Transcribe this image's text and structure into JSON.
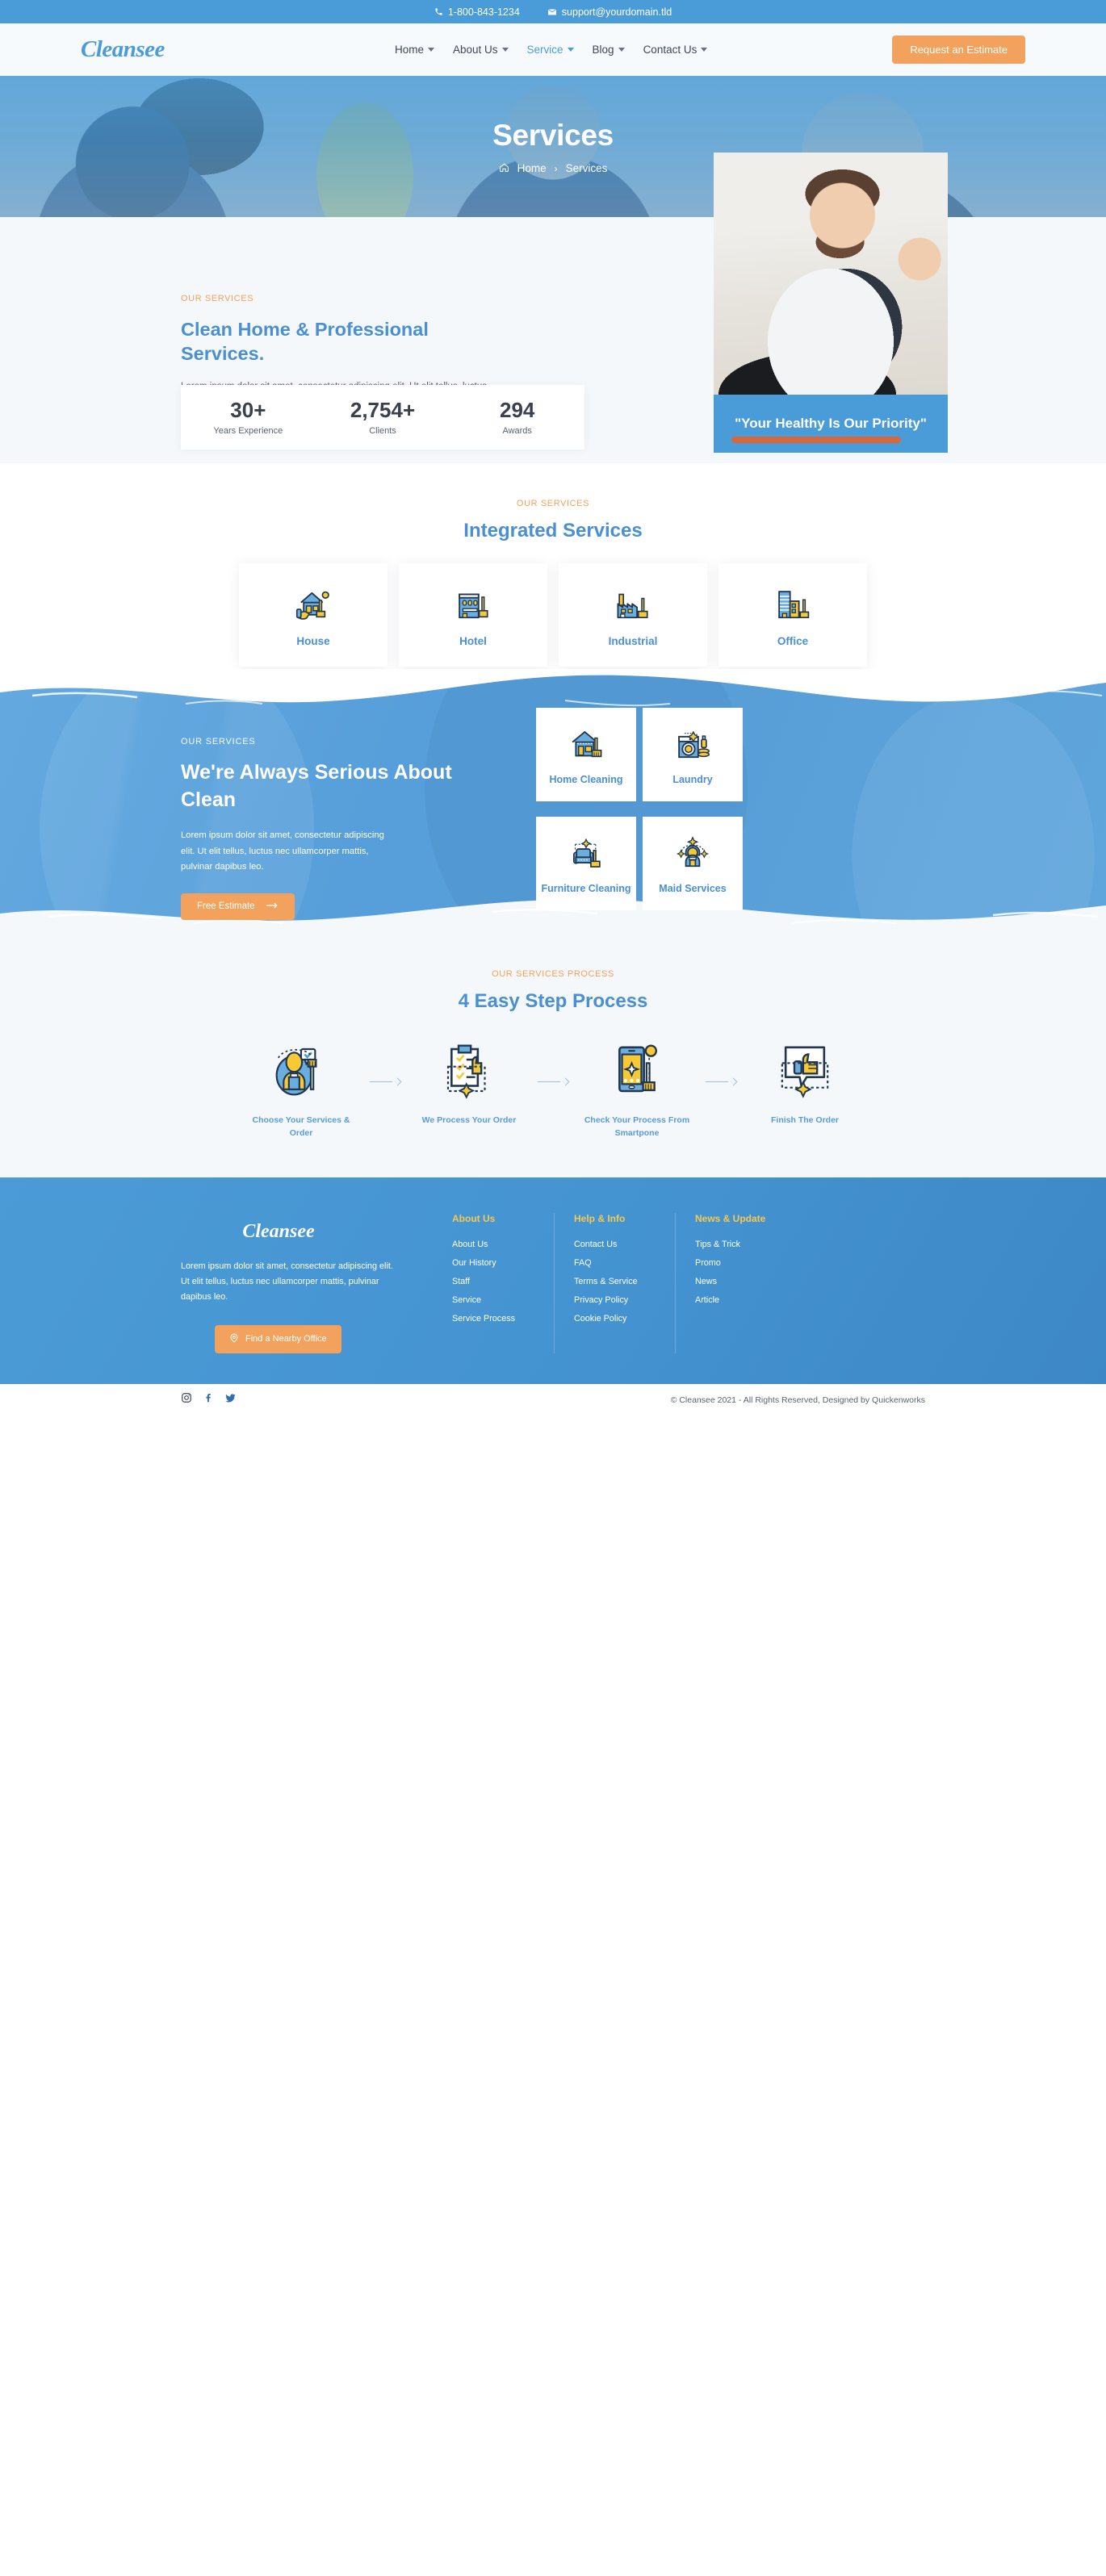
{
  "topbar": {
    "phone": "1-800-843-1234",
    "email": "support@yourdomain.tld",
    "phone_icon": "phone-icon",
    "email_icon": "envelope-icon"
  },
  "header": {
    "logo": "Cleansee",
    "nav": [
      {
        "label": "Home",
        "active": false
      },
      {
        "label": "About Us",
        "active": false
      },
      {
        "label": "Service",
        "active": true
      },
      {
        "label": "Blog",
        "active": false
      },
      {
        "label": "Contact Us",
        "active": false
      }
    ],
    "cta": "Request an Estimate"
  },
  "hero": {
    "title": "Services",
    "breadcrumb": {
      "home_icon": "home-icon",
      "home": "Home",
      "separator": "›",
      "current": "Services"
    }
  },
  "about": {
    "eyebrow": "OUR SERVICES",
    "heading": "Clean Home & Professional Services.",
    "paragraph": "Lorem ipsum dolor sit amet, consectetur adipiscing elit. Ut elit tellus, luctus nec ullamcorper mattis, pulvinar dapibus leo.",
    "stats": [
      {
        "number": "30+",
        "label": "Years Experience"
      },
      {
        "number": "2,754+",
        "label": "Clients"
      },
      {
        "number": "294",
        "label": "Awards"
      }
    ],
    "quote": "\"Your Healthy Is Our Priority\""
  },
  "integrated": {
    "eyebrow": "OUR SERVICES",
    "heading": "Integrated Services",
    "cards": [
      {
        "label": "House",
        "icon": "house-cleaning-icon"
      },
      {
        "label": "Hotel",
        "icon": "hotel-cleaning-icon"
      },
      {
        "label": "Industrial",
        "icon": "industrial-cleaning-icon"
      },
      {
        "label": "Office",
        "icon": "office-cleaning-icon"
      }
    ]
  },
  "serious": {
    "eyebrow": "OUR SERVICES",
    "heading": "We're Always Serious About Clean",
    "paragraph": "Lorem ipsum dolor sit amet, consectetur adipiscing elit. Ut elit tellus, luctus nec ullamcorper mattis, pulvinar dapibus leo.",
    "cta": "Free Estimate",
    "cards": [
      {
        "label": "Home Cleaning",
        "icon": "home-cleaning-icon"
      },
      {
        "label": "Laundry",
        "icon": "laundry-icon"
      },
      {
        "label": "Furniture Cleaning",
        "icon": "furniture-cleaning-icon"
      },
      {
        "label": "Maid Services",
        "icon": "maid-icon"
      }
    ]
  },
  "process": {
    "eyebrow": "OUR SERVICES PROCESS",
    "heading": "4 Easy Step Process",
    "steps": [
      {
        "label": "Choose Your Services & Order",
        "icon": "person-order-icon"
      },
      {
        "label": "We Process Your Order",
        "icon": "clipboard-checklist-icon"
      },
      {
        "label": "Check Your Process From Smartpone",
        "icon": "smartphone-icon"
      },
      {
        "label": "Finish The Order",
        "icon": "thumbs-up-icon"
      }
    ]
  },
  "footer": {
    "logo": "Cleansee",
    "paragraph": "Lorem ipsum dolor sit amet, consectetur adipiscing elit. Ut elit tellus, luctus nec ullamcorper mattis, pulvinar dapibus leo.",
    "office_btn": "Find a Nearby Office",
    "office_icon": "location-pin-icon",
    "columns": [
      {
        "title": "About Us",
        "items": [
          "About Us",
          "Our History",
          "Staff",
          "Service",
          "Service Process"
        ]
      },
      {
        "title": "Help & Info",
        "items": [
          "Contact Us",
          "FAQ",
          "Terms & Service",
          "Privacy Policy",
          "Cookie Policy"
        ]
      },
      {
        "title": "News & Update",
        "items": [
          "Tips & Trick",
          "Promo",
          "News",
          "Article"
        ]
      }
    ],
    "socials": [
      {
        "name": "instagram-icon"
      },
      {
        "name": "facebook-icon"
      },
      {
        "name": "twitter-icon"
      }
    ],
    "copyright": "© Cleansee 2021 - All Rights Reserved, Designed by Quickenworks"
  },
  "colors": {
    "brand_blue": "#4a9cd8",
    "heading_blue": "#4a8fd0",
    "accent_orange": "#f2a25c",
    "footer_gold": "#f4c852",
    "icon_yellow": "#f6c935",
    "icon_navy": "#22374f"
  }
}
